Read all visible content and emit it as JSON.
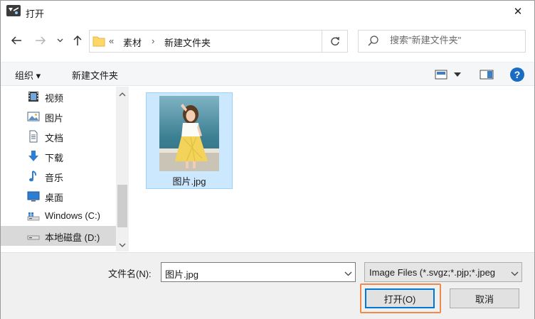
{
  "window": {
    "title": "打开",
    "close_glyph": "✕"
  },
  "nav": {
    "back_icon": "arrow-left-icon",
    "forward_icon": "arrow-right-icon",
    "recent_icon": "chevron-down-icon",
    "up_icon": "arrow-up-icon"
  },
  "address": {
    "overflow": "«",
    "crumbs": [
      "素材",
      "新建文件夹"
    ],
    "separator": "›"
  },
  "search": {
    "placeholder": "搜索\"新建文件夹\""
  },
  "toolbar": {
    "organize": "组织 ▾",
    "new_folder": "新建文件夹",
    "help": "?"
  },
  "sidebar": {
    "items": [
      {
        "label": "视频",
        "icon": "video-icon"
      },
      {
        "label": "图片",
        "icon": "pictures-icon"
      },
      {
        "label": "文档",
        "icon": "documents-icon"
      },
      {
        "label": "下载",
        "icon": "downloads-icon"
      },
      {
        "label": "音乐",
        "icon": "music-icon"
      },
      {
        "label": "桌面",
        "icon": "desktop-icon"
      },
      {
        "label": "Windows (C:)",
        "icon": "drive-c-icon"
      },
      {
        "label": "本地磁盘 (D:)",
        "icon": "drive-d-icon",
        "selected": true
      }
    ]
  },
  "files": [
    {
      "name": "图片.jpg",
      "selected": true
    }
  ],
  "footer": {
    "filename_label": "文件名(N):",
    "filename_value": "图片.jpg",
    "filetype_value": "Image Files (*.svgz;*.pjp;*.jpeg",
    "open_label": "打开(O)",
    "cancel_label": "取消"
  },
  "colors": {
    "accent": "#0078d7",
    "selection": "#cce8ff",
    "highlight": "#f08a4b"
  }
}
